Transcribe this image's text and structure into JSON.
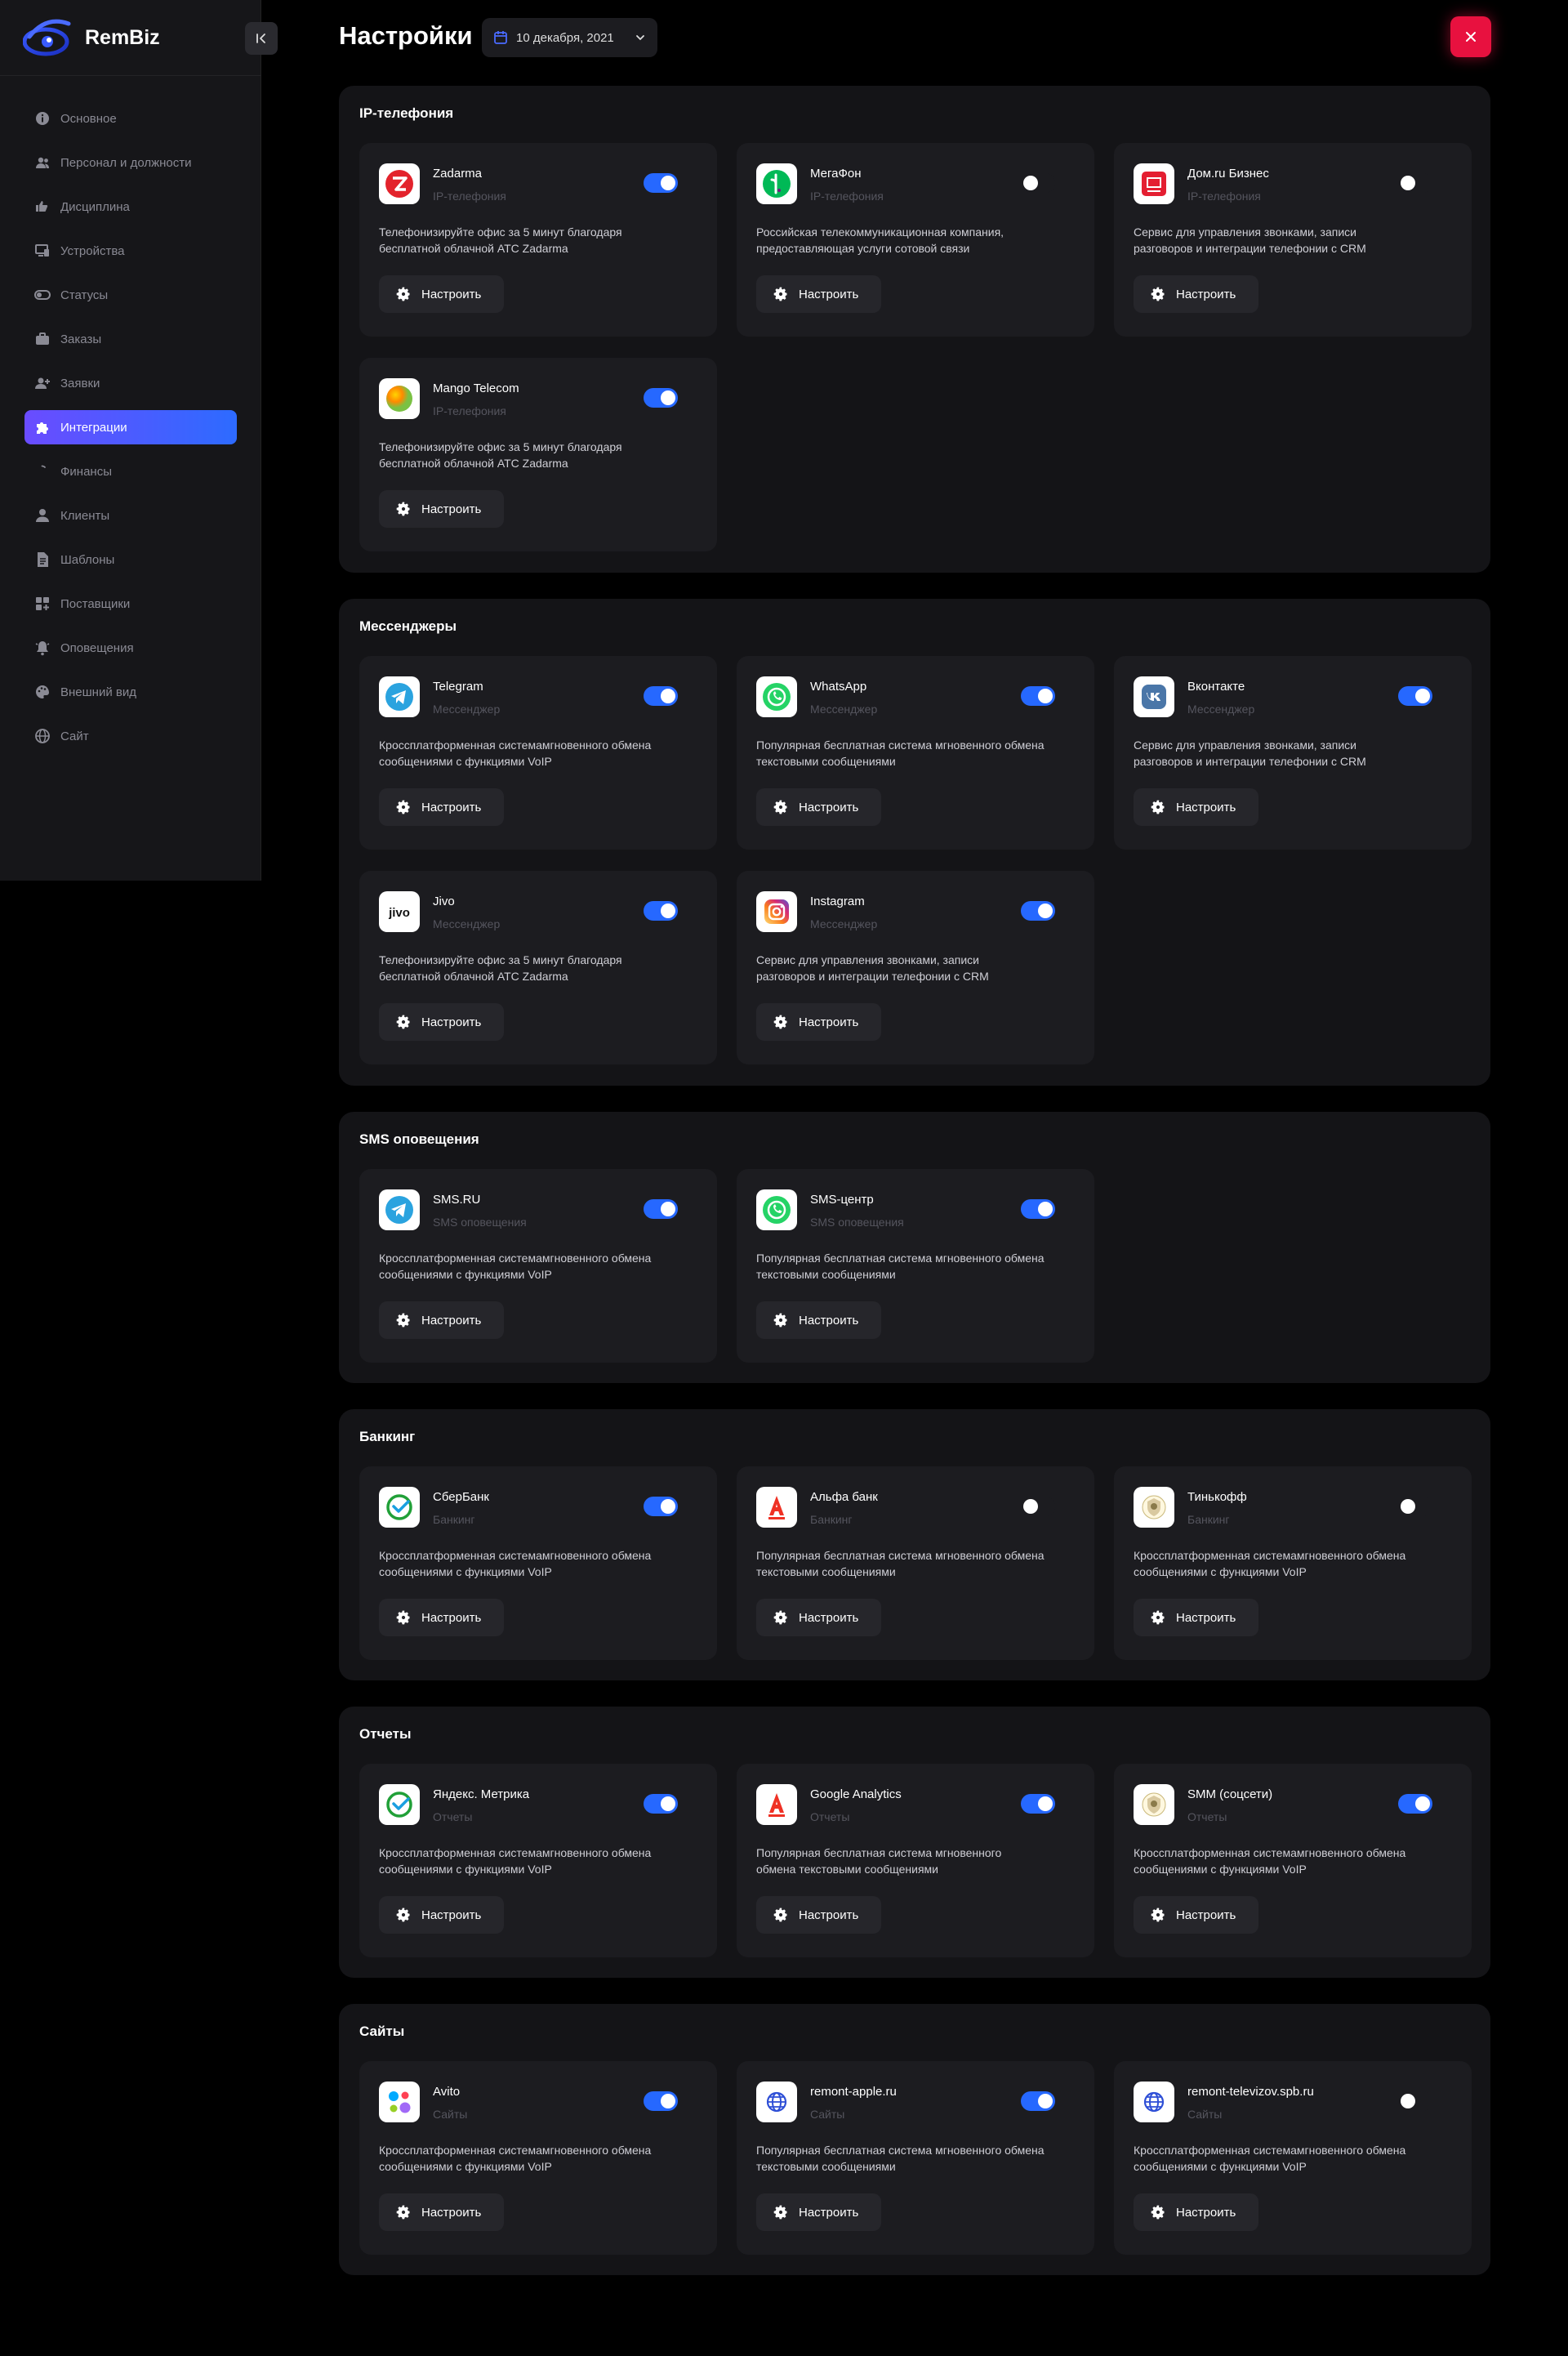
{
  "app": {
    "name": "RemBiz"
  },
  "header": {
    "title": "Настройки",
    "date": "10 декабря, 2021"
  },
  "sidebar": {
    "items": [
      {
        "label": "Основное",
        "icon": "info-icon",
        "active": false
      },
      {
        "label": "Персонал и должности",
        "icon": "users-icon",
        "active": false
      },
      {
        "label": "Дисциплина",
        "icon": "thumbs-icon",
        "active": false
      },
      {
        "label": "Устройства",
        "icon": "devices-icon",
        "active": false
      },
      {
        "label": "Статусы",
        "icon": "toggle-icon",
        "active": false
      },
      {
        "label": "Заказы",
        "icon": "briefcase-icon",
        "active": false
      },
      {
        "label": "Заявки",
        "icon": "user-plus-icon",
        "active": false
      },
      {
        "label": "Интеграции",
        "icon": "puzzle-icon",
        "active": true
      },
      {
        "label": "Финансы",
        "icon": "dollar-icon",
        "active": false
      },
      {
        "label": "Клиенты",
        "icon": "user-icon",
        "active": false
      },
      {
        "label": "Шаблоны",
        "icon": "document-icon",
        "active": false
      },
      {
        "label": "Поставщики",
        "icon": "grid-plus-icon",
        "active": false
      },
      {
        "label": "Оповещения",
        "icon": "bell-icon",
        "active": false
      },
      {
        "label": "Внешний вид",
        "icon": "palette-icon",
        "active": false
      },
      {
        "label": "Сайт",
        "icon": "globe-icon",
        "active": false
      }
    ]
  },
  "configure_label": "Настроить",
  "colors": {
    "accent": "#2668ff",
    "close": "#e8113f",
    "active_gradient": [
      "#6a4cff",
      "#2d6bff"
    ]
  },
  "sections": [
    {
      "title": "IP-телефония",
      "cards": [
        {
          "name": "Zadarma",
          "category": "IP-телефония",
          "enabled": true,
          "logo": "zadarma-logo",
          "desc1": "Телефонизируйте офис за 5 минут благодаря",
          "desc2": "бесплатной облачной АТС Zadarma"
        },
        {
          "name": "МегаФон",
          "category": "IP-телефония",
          "enabled": false,
          "logo": "megafon-logo",
          "desc1": "Российская телекоммуникационная компания,",
          "desc2": "предоставляющая услуги сотовой связи"
        },
        {
          "name": "Дом.ru Бизнес",
          "category": "IP-телефония",
          "enabled": false,
          "logo": "domru-logo",
          "desc1": "Сервис для управления звонками, записи",
          "desc2": "разговоров и интеграции телефонии с CRM"
        },
        {
          "name": "Mango Telecom",
          "category": "IP-телефония",
          "enabled": true,
          "logo": "mango-logo",
          "desc1": "Телефонизируйте офис за 5 минут благодаря",
          "desc2": "бесплатной облачной АТС Zadarma"
        }
      ]
    },
    {
      "title": "Мессенджеры",
      "cards": [
        {
          "name": "Telegram",
          "category": "Мессенджер",
          "enabled": true,
          "logo": "telegram-logo",
          "desc1": "Кроссплатформенная системамгновенного обмена",
          "desc2": "сообщениями с функциями VoIP"
        },
        {
          "name": "WhatsApp",
          "category": "Мессенджер",
          "enabled": true,
          "logo": "whatsapp-logo",
          "desc1": "Популярная бесплатная система мгновенного обмена",
          "desc2": "текстовыми сообщениями"
        },
        {
          "name": "Вконтакте",
          "category": "Мессенджер",
          "enabled": true,
          "logo": "vk-logo",
          "desc1": "Сервис для управления звонками, записи",
          "desc2": "разговоров и интеграции телефонии с CRM"
        },
        {
          "name": "Jivo",
          "category": "Мессенджер",
          "enabled": true,
          "logo": "jivo-logo",
          "desc1": "Телефонизируйте офис за 5 минут благодаря",
          "desc2": "бесплатной облачной АТС Zadarma"
        },
        {
          "name": "Instagram",
          "category": "Мессенджер",
          "enabled": true,
          "logo": "instagram-logo",
          "desc1": "Сервис для управления звонками, записи",
          "desc2": "разговоров и интеграции телефонии с CRM"
        }
      ]
    },
    {
      "title": "SMS оповещения",
      "cards": [
        {
          "name": "SMS.RU",
          "category": "SMS оповещения",
          "enabled": true,
          "logo": "telegram-logo",
          "desc1": "Кроссплатформенная системамгновенного обмена",
          "desc2": "сообщениями с функциями VoIP"
        },
        {
          "name": "SMS-центр",
          "category": "SMS оповещения",
          "enabled": true,
          "logo": "whatsapp-logo",
          "desc1": "Популярная бесплатная система мгновенного обмена",
          "desc2": "текстовыми сообщениями"
        }
      ]
    },
    {
      "title": "Банкинг",
      "cards": [
        {
          "name": "СберБанк",
          "category": "Банкинг",
          "enabled": true,
          "logo": "sber-logo",
          "desc1": "Кроссплатформенная системамгновенного обмена",
          "desc2": "сообщениями с функциями VoIP"
        },
        {
          "name": "Альфа банк",
          "category": "Банкинг",
          "enabled": false,
          "logo": "alfa-logo",
          "desc1": "Популярная бесплатная система мгновенного обмена",
          "desc2": "текстовыми сообщениями"
        },
        {
          "name": "Тинькофф",
          "category": "Банкинг",
          "enabled": false,
          "logo": "tinkoff-logo",
          "desc1": "Кроссплатформенная системамгновенного обмена",
          "desc2": "сообщениями с функциями VoIP"
        }
      ]
    },
    {
      "title": "Отчеты",
      "cards": [
        {
          "name": "Яндекс. Метрика",
          "category": "Отчеты",
          "enabled": true,
          "logo": "sber-logo",
          "desc1": "Кроссплатформенная системамгновенного обмена",
          "desc2": "сообщениями с функциями VoIP"
        },
        {
          "name": "Google Analytics",
          "category": "Отчеты",
          "enabled": true,
          "logo": "alfa-logo",
          "desc1": "Популярная бесплатная система мгновенного",
          "desc2": "обмена текстовыми сообщениями"
        },
        {
          "name": "SMM (соцсети)",
          "category": "Отчеты",
          "enabled": true,
          "logo": "tinkoff-logo",
          "desc1": "Кроссплатформенная системамгновенного обмена",
          "desc2": "сообщениями с функциями VoIP"
        }
      ]
    },
    {
      "title": "Сайты",
      "cards": [
        {
          "name": "Avito",
          "category": "Сайты",
          "enabled": true,
          "logo": "avito-logo",
          "desc1": "Кроссплатформенная системамгновенного обмена",
          "desc2": "сообщениями с функциями VoIP"
        },
        {
          "name": "remont-apple.ru",
          "category": "Сайты",
          "enabled": true,
          "logo": "globe-logo",
          "desc1": "Популярная бесплатная система мгновенного обмена",
          "desc2": "текстовыми сообщениями"
        },
        {
          "name": "remont-televizov.spb.ru",
          "category": "Сайты",
          "enabled": false,
          "logo": "globe-logo",
          "desc1": "Кроссплатформенная системамгновенного обмена",
          "desc2": "сообщениями с функциями VoIP"
        }
      ]
    }
  ]
}
